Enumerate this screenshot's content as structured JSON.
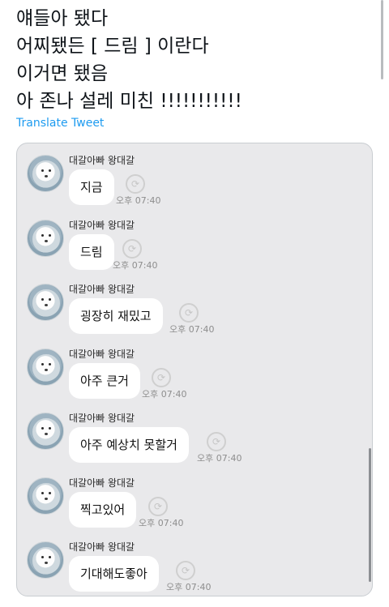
{
  "tweet": {
    "lines": [
      "얘들아 됐다",
      "어찌됐든 [ 드림 ] 이란다",
      "이거면 됐음",
      "아 존나 설레 미친 !!!!!!!!!!!"
    ],
    "translate_label": "Translate Tweet"
  },
  "chat": {
    "messages": [
      {
        "sender": "대갈아빠 왕대갈",
        "text": "지금",
        "time": "오후 07:40"
      },
      {
        "sender": "대갈아빠 왕대갈",
        "text": "드림",
        "time": "오후 07:40"
      },
      {
        "sender": "대갈아빠 왕대갈",
        "text": "굉장히 재밌고",
        "time": "오후 07:40"
      },
      {
        "sender": "대갈아빠 왕대갈",
        "text": "아주 큰거",
        "time": "오후 07:40"
      },
      {
        "sender": "대갈아빠 왕대갈",
        "text": "아주 예상치 못할거",
        "time": "오후 07:40"
      },
      {
        "sender": "대갈아빠 왕대갈",
        "text": "찍고있어",
        "time": "오후 07:40"
      },
      {
        "sender": "대갈아빠 왕대갈",
        "text": "기대해도좋아",
        "time": "오후 07:40"
      }
    ]
  },
  "icons": {
    "avatar": "dog-avatar",
    "read_status": "refresh-icon"
  },
  "colors": {
    "link": "#1d9bf0",
    "chat_background": "#e9e9eb",
    "bubble": "#ffffff"
  }
}
